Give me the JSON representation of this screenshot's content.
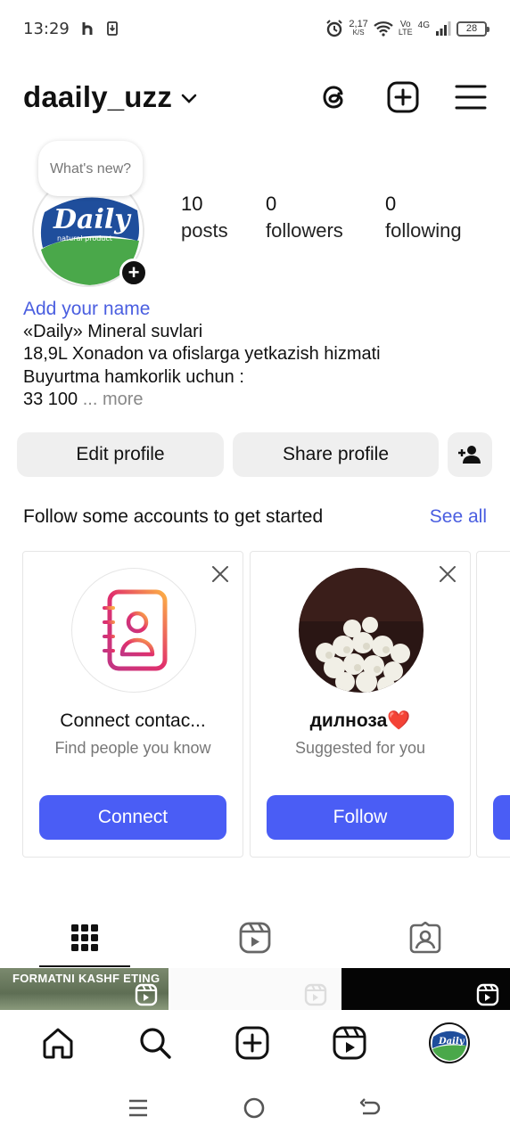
{
  "status_bar": {
    "time": "13:29",
    "net_speed_value": "2,17",
    "net_speed_unit": "K/S",
    "volte_top": "Vo",
    "volte_bottom": "LTE",
    "signal_label": "4G",
    "battery": "28"
  },
  "header": {
    "username": "daaily_uzz"
  },
  "profile": {
    "note_text": "What's new?",
    "avatar_brand": "Daily",
    "avatar_sub": "natural product",
    "stats": [
      {
        "value": "10",
        "label": "posts"
      },
      {
        "value": "0",
        "label": "followers"
      },
      {
        "value": "0",
        "label": "following"
      }
    ],
    "bio": {
      "add_name": "Add your name",
      "line1": "«Daily» Mineral suvlari",
      "line2": "18,9L Xonadon va ofislarga yetkazish hizmati",
      "line3": "Buyurtma hamkorlik uchun :",
      "line4": "33 100",
      "more": "... more"
    }
  },
  "actions": {
    "edit_profile": "Edit profile",
    "share_profile": "Share profile"
  },
  "suggestions": {
    "heading": "Follow some accounts to get started",
    "see_all": "See all",
    "cards": [
      {
        "title": "Connect contac...",
        "subtitle": "Find people you know",
        "cta": "Connect"
      },
      {
        "title": "дилноза❤️",
        "subtitle": "Suggested for you",
        "cta": "Follow"
      }
    ]
  },
  "grid": {
    "thumb1_text": "FORMATNI KASHF ETING"
  },
  "colors": {
    "accent": "#4a5df5",
    "link": "#4a5ee0"
  }
}
